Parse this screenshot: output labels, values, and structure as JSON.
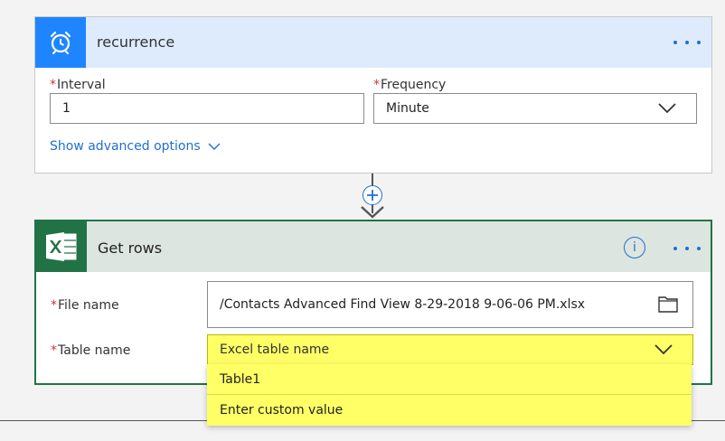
{
  "recurrence": {
    "title": "recurrence",
    "interval_label": "Interval",
    "interval_value": "1",
    "frequency_label": "Frequency",
    "frequency_value": "Minute",
    "advanced_link": "Show advanced options",
    "required_mark": "*"
  },
  "get_rows": {
    "title": "Get rows",
    "info_label": "i",
    "file_label": "File name",
    "file_value": "/Contacts Advanced Find View 8-29-2018 9-06-06 PM.xlsx",
    "table_label": "Table name",
    "table_placeholder": "Excel table name",
    "required_mark": "*"
  },
  "dropdown": {
    "options": [
      "Table1",
      "Enter custom value"
    ]
  },
  "colors": {
    "recurrence_accent": "#1f85ff",
    "excel_accent": "#217346",
    "link": "#1f6fd1",
    "highlight": "#ffff66",
    "required": "#d13438"
  },
  "icons": {
    "recurrence": "alarm-clock-icon",
    "excel": "excel-icon",
    "more": "more-options-icon",
    "info": "info-icon",
    "folder": "folder-icon",
    "chevron": "chevron-down-icon",
    "add": "add-step-icon"
  }
}
